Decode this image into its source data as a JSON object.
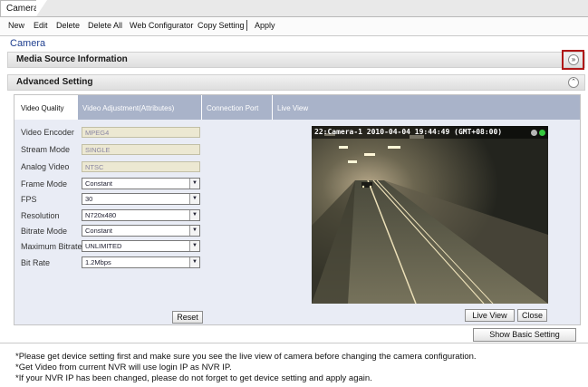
{
  "window": {
    "tab_title": "Camera"
  },
  "toolbar": {
    "new": "New",
    "edit": "Edit",
    "delete": "Delete",
    "delete_all": "Delete All",
    "web_configurator": "Web Configurator",
    "copy_setting": "Copy Setting",
    "apply": "Apply"
  },
  "page": {
    "title": "Camera"
  },
  "media_section": {
    "title": "Media Source Information",
    "toggle_icon": "double-chevron-down-icon"
  },
  "advanced_section": {
    "title": "Advanced Setting",
    "toggle_icon": "double-chevron-up-icon"
  },
  "tabs": [
    {
      "label": "Video Quality",
      "active": true
    },
    {
      "label": "Video Adjustment(Attributes)",
      "active": false
    },
    {
      "label": "Connection Port",
      "active": false
    },
    {
      "label": "Live View",
      "active": false
    }
  ],
  "fields": {
    "video_encoder": {
      "label": "Video Encoder",
      "value": "MPEG4"
    },
    "stream_mode": {
      "label": "Stream Mode",
      "value": "SINGLE"
    },
    "analog_video": {
      "label": "Analog Video",
      "value": "NTSC"
    },
    "frame_mode": {
      "label": "Frame Mode",
      "value": "Constant"
    },
    "fps": {
      "label": "FPS",
      "value": "30"
    },
    "resolution": {
      "label": "Resolution",
      "value": "N720x480"
    },
    "bitrate_mode": {
      "label": "Bitrate Mode",
      "value": "Constant"
    },
    "maximum_bitrate": {
      "label": "Maximum Bitrate",
      "value": "UNLIMITED"
    },
    "bit_rate": {
      "label": "Bit Rate",
      "value": "1.2Mbps"
    }
  },
  "buttons": {
    "reset": "Reset",
    "live_view": "Live View",
    "close": "Close",
    "show_basic": "Show Basic Setting"
  },
  "video": {
    "overlay": "22:Camera-1   2010-04-04 19:44:49 (GMT+08:00)"
  },
  "notes": [
    "*Please get device setting first and make sure you see the live view of camera before changing the camera configuration.",
    "*Get Video from current NVR will use login IP as NVR IP.",
    "*If your NVR IP has been changed, please do not forget to get device setting and apply again."
  ],
  "colors": {
    "tab_strip": "#a9b3c9",
    "content_bg": "#e9ecf5",
    "title_blue": "#1f3f8f",
    "highlight_red": "#b01818"
  }
}
